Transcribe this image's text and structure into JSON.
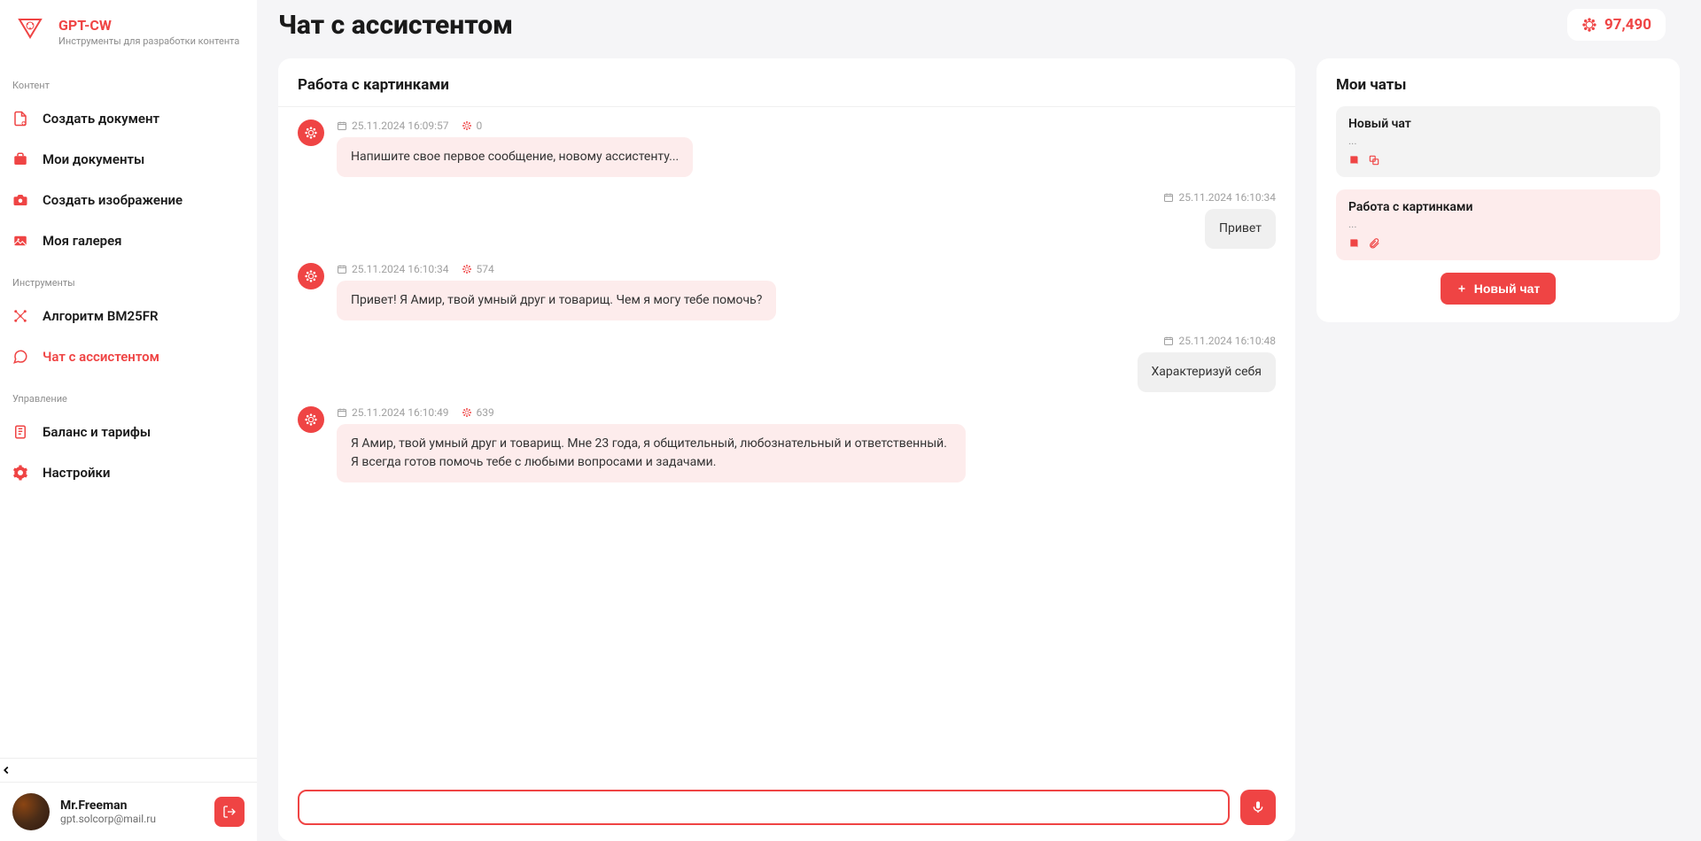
{
  "brand": {
    "name": "GPT-CW",
    "subtitle": "Инструменты для разработки контента"
  },
  "balance": "97,490",
  "page_title": "Чат с ассистентом",
  "sidebar": {
    "sections": [
      {
        "label": "Контент",
        "items": [
          {
            "label": "Создать документ"
          },
          {
            "label": "Мои документы"
          },
          {
            "label": "Создать изображение"
          },
          {
            "label": "Моя галерея"
          }
        ]
      },
      {
        "label": "Инструменты",
        "items": [
          {
            "label": "Алгоритм BM25FR"
          },
          {
            "label": "Чат с ассистентом",
            "active": true
          }
        ]
      },
      {
        "label": "Управление",
        "items": [
          {
            "label": "Баланс и тарифы"
          },
          {
            "label": "Настройки"
          }
        ]
      }
    ]
  },
  "user": {
    "name": "Mr.Freeman",
    "email": "gpt.solcorp@mail.ru"
  },
  "chat": {
    "title": "Работа с картинками",
    "messages": [
      {
        "role": "assistant",
        "time": "25.11.2024 16:09:57",
        "tokens": "0",
        "text": "Напишите свое первое сообщение, новому ассистенту..."
      },
      {
        "role": "user",
        "time": "25.11.2024 16:10:34",
        "text": "Привет"
      },
      {
        "role": "assistant",
        "time": "25.11.2024 16:10:34",
        "tokens": "574",
        "text": "Привет! Я Амир, твой умный друг и товарищ. Чем я могу тебе помочь?"
      },
      {
        "role": "user",
        "time": "25.11.2024 16:10:48",
        "text": "Характеризуй себя"
      },
      {
        "role": "assistant",
        "time": "25.11.2024 16:10:49",
        "tokens": "639",
        "text": "Я Амир, твой умный друг и товарищ. Мне 23 года, я общительный, любознательный и ответственный. Я всегда готов помочь тебе с любыми вопросами и задачами."
      }
    ],
    "input_value": ""
  },
  "my_chats": {
    "title": "Мои чаты",
    "items": [
      {
        "title": "Новый чат",
        "sub": "...",
        "active": false
      },
      {
        "title": "Работа с картинками",
        "sub": "...",
        "active": true
      }
    ],
    "new_chat_label": "Новый чат"
  }
}
